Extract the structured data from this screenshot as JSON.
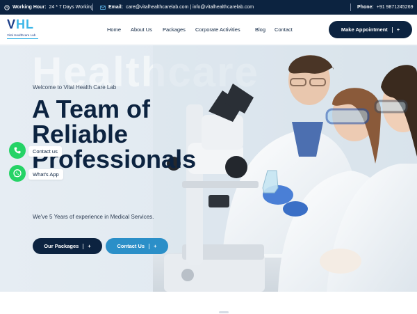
{
  "topbar": {
    "hours_label": "Working Hour:",
    "hours_value": "24 * 7 Days Working",
    "email_label": "Email:",
    "email_value": "care@vitalhealthcarelab.com | info@vitalhealthcarelab.com",
    "phone_label": "Phone:",
    "phone_value": "+91 9871245269"
  },
  "logo": {
    "mark_v": "V",
    "mark_hl": "HL",
    "subtitle": "Vital Healthcare Lab"
  },
  "nav": {
    "items": [
      "Home",
      "About Us",
      "Packages",
      "Corporate Activities",
      "Blog",
      "Contact"
    ],
    "cta_label": "Make Appointment",
    "cta_icon": "+"
  },
  "hero": {
    "watermark": "Healthcare",
    "welcome": "Welcome to Vital Health Care Lab",
    "headline": "A Team of Reliable Professionals",
    "experience": "We've 5 Years of experience in Medical Services.",
    "primary_btn": "Our Packages",
    "secondary_btn": "Contact Us",
    "btn_icon": "+"
  },
  "floating": {
    "call_label": "Contact us",
    "whatsapp_label": "What's App"
  },
  "colors": {
    "navy": "#0c2340",
    "blue": "#2b8fc8",
    "green": "#25d366"
  }
}
